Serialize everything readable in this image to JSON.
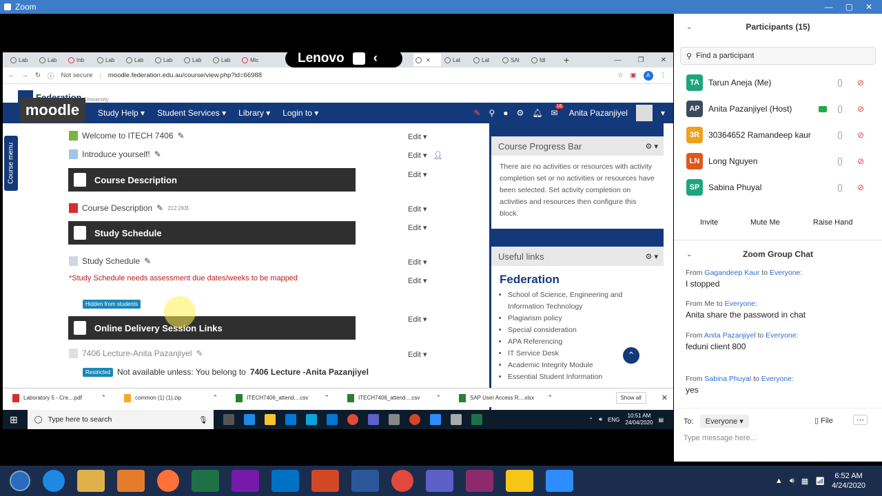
{
  "zoom_window": {
    "title": "Zoom"
  },
  "browser": {
    "tabs": [
      "Lab",
      "Lab",
      "Inb",
      "Lab",
      "Lab",
      "Lab",
      "Lab",
      "Lab",
      "Mic",
      "fdl",
      "",
      "Lat",
      "Lat",
      "SAI",
      "fdl"
    ],
    "lenovo_overlay": "Lenovo",
    "address": {
      "security": "Not secure",
      "url": "moodle.federation.edu.au/course/view.php?id=66988"
    }
  },
  "moodle": {
    "org_name": "Federation",
    "org_sub": "University",
    "logo": "moodle",
    "nav": [
      "Study Help ▾",
      "Student Services ▾",
      "Library ▾",
      "Login to ▾"
    ],
    "user_name": "Anita Pazanjiyel",
    "notification_count": "16",
    "course_menu": "Course menu",
    "items": {
      "welcome": "Welcome to ITECH 7406",
      "introduce": "Introduce yourself!",
      "section_course_desc": "Course Description",
      "course_desc_file": "Course Description",
      "course_desc_size": "212.2KB",
      "section_study_schedule": "Study Schedule",
      "study_schedule_file": "Study Schedule",
      "schedule_note": "*Study Schedule needs assessment due dates/weeks to be mapped",
      "hidden_badge": "Hidden from students",
      "section_online": "Online Delivery Session Links",
      "lecture_link": "7406 Lecture-Anita Pazanjiyel",
      "restricted_badge": "Restricted",
      "restricted_text": "Not available unless: You belong to",
      "restricted_bold": "7406 Lecture -Anita Pazanjiyel"
    },
    "edit_label": "Edit",
    "progress_block": {
      "title": "Course Progress Bar",
      "body": "There are no activities or resources with activity completion set or no activities or resources have been selected. Set activity completion on activities and resources then configure this block."
    },
    "links_block": {
      "title": "Useful links",
      "logo": "Federation",
      "links": [
        "School of Science, Engineering and Information Technology",
        "Plagiarism policy",
        "Special consideration",
        "APA Referencing",
        "IT Service Desk",
        "Academic Integrity Module",
        "Essential Student Information"
      ]
    }
  },
  "downloads": {
    "items": [
      "Laboratory 5 - Cre....pdf",
      "common (1) (1).zip",
      "ITECH7406_attend....csv",
      "ITECH7406_attend....csv",
      "SAP User Access R....xlsx"
    ],
    "show_all": "Show all"
  },
  "inner_taskbar": {
    "search_placeholder": "Type here to search",
    "lang": "ENG",
    "time": "10:51 AM",
    "date": "24/04/2020"
  },
  "zoom_panel": {
    "participants_title": "Participants (15)",
    "find_placeholder": "Find a participant",
    "participants": [
      {
        "initials": "TA",
        "name": "Tarun Aneja (Me)",
        "color": "#1fa57d"
      },
      {
        "initials": "AP",
        "name": "Anita Pazanjiyel (Host)",
        "color": "#3d4a5c"
      },
      {
        "initials": "3R",
        "name": "30364652 Ramandeep kaur",
        "color": "#f0a020"
      },
      {
        "initials": "LN",
        "name": "Long Nguyen",
        "color": "#e0571a"
      },
      {
        "initials": "SP",
        "name": "Sabina Phuyal",
        "color": "#1fa57d"
      }
    ],
    "buttons": {
      "invite": "Invite",
      "mute_me": "Mute Me",
      "raise_hand": "Raise Hand"
    },
    "chat_title": "Zoom Group Chat",
    "messages": [
      {
        "from_label": "From",
        "sender": "Gagandeep Kaur",
        "to_label": "to",
        "recipient": "Everyone:",
        "text": "I stopped"
      },
      {
        "from_label": "From Me",
        "sender": "",
        "to_label": "to",
        "recipient": "Everyone:",
        "text": "Anita share the password in chat"
      },
      {
        "from_label": "From",
        "sender": "Anita Pazanjiyel",
        "to_label": "to",
        "recipient": "Everyone:",
        "text": "feduni client 800"
      },
      {
        "from_label": "From",
        "sender": "Sabina Phuyal",
        "to_label": "to",
        "recipient": "Everyone:",
        "text": "yes"
      }
    ],
    "to_label": "To:",
    "to_value": "Everyone ▾",
    "file_label": "File",
    "message_placeholder": "Type message here..."
  },
  "bottom_taskbar": {
    "time": "6:52 AM",
    "date": "4/24/2020"
  }
}
